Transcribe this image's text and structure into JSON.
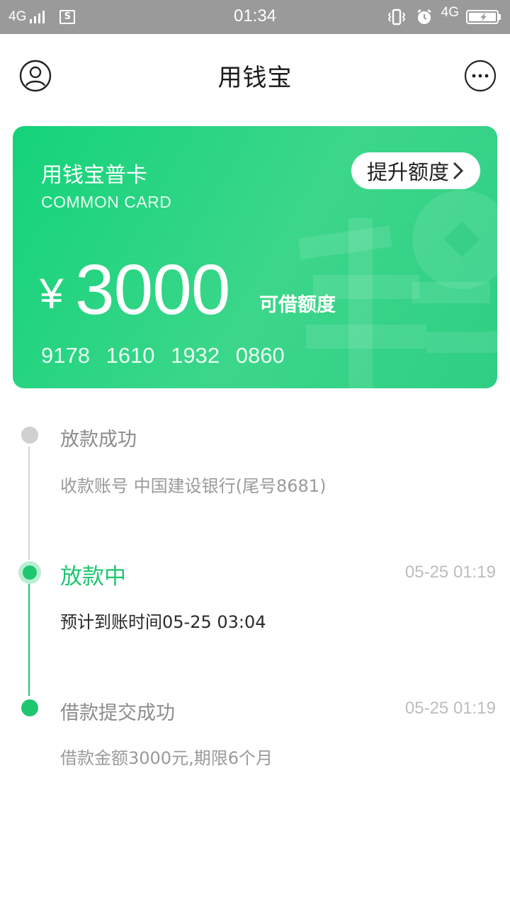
{
  "status_bar": {
    "network_left": "4G",
    "time": "01:34",
    "network_right": "4G",
    "sim_label": "S"
  },
  "header": {
    "title": "用钱宝",
    "left_icon": "user-icon",
    "right_icon": "more-icon"
  },
  "card": {
    "name": "用钱宝普卡",
    "subtitle": "COMMON CARD",
    "raise_button": "提升额度",
    "currency": "¥",
    "amount": "3000",
    "amount_label": "可借额度",
    "card_number": "9178 1610 1932 0860",
    "accent_color": "#1ed27c"
  },
  "timeline": [
    {
      "title": "放款成功",
      "time": "",
      "desc": "收款账号 中国建设银行(尾号8681)",
      "state": "pending"
    },
    {
      "title": "放款中",
      "time": "05-25 01:19",
      "desc": "预计到账时间05-25 03:04",
      "state": "active"
    },
    {
      "title": "借款提交成功",
      "time": "05-25 01:19",
      "desc": "借款金额3000元,期限6个月",
      "state": "done"
    }
  ],
  "colors": {
    "active_green": "#1ec670",
    "inactive_gray": "#d0d0d0",
    "status_bar": "#9a9a9a"
  }
}
